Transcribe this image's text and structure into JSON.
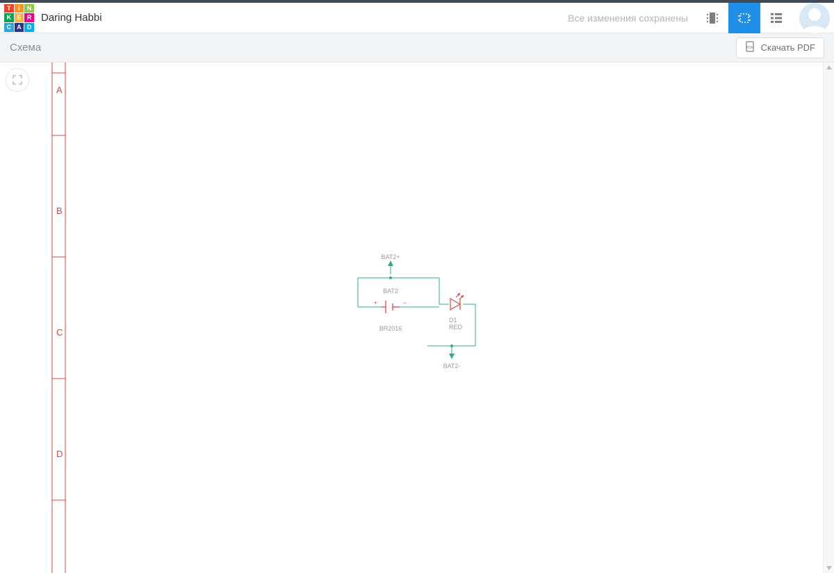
{
  "header": {
    "project_title": "Daring Habbi",
    "saved_status": "Все изменения сохранены"
  },
  "logo_letters": [
    "T",
    "I",
    "N",
    "K",
    "E",
    "R",
    "C",
    "A",
    "D"
  ],
  "subheader": {
    "title": "Схема",
    "pdf_button": "Скачать PDF"
  },
  "ruler_rows": [
    "A",
    "B",
    "C",
    "D"
  ],
  "schematic": {
    "net_top": "BAT2+",
    "net_bottom": "BAT2-",
    "battery": {
      "ref": "BAT2",
      "value": "BR2016",
      "plus": "+",
      "minus": "−"
    },
    "led": {
      "ref": "D1",
      "value": "RED"
    }
  }
}
